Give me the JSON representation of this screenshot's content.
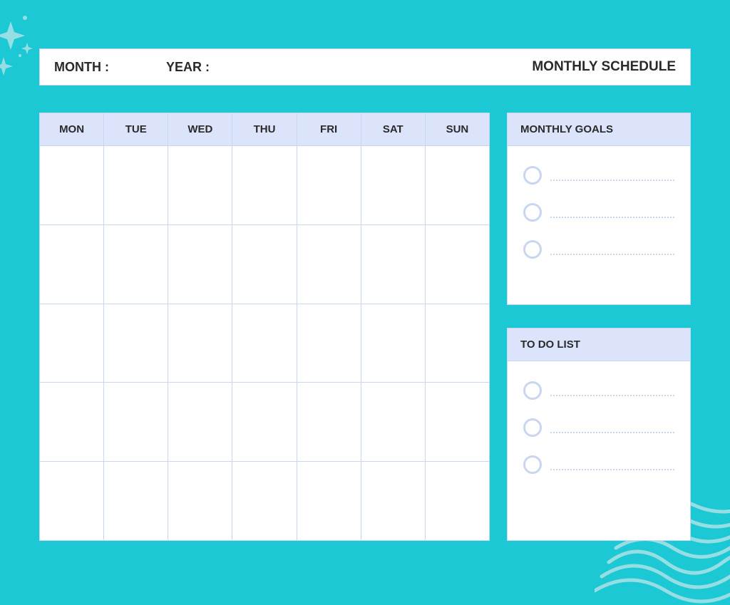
{
  "header": {
    "month_label": "MONTH :",
    "year_label": "YEAR :",
    "title": "MONTHLY SCHEDULE"
  },
  "calendar": {
    "days": [
      "MON",
      "TUE",
      "WED",
      "THU",
      "FRI",
      "SAT",
      "SUN"
    ],
    "rows": 5
  },
  "goals_panel": {
    "title": "MONTHLY GOALS",
    "items": 3
  },
  "todo_panel": {
    "title": "TO DO LIST",
    "items": 3
  }
}
